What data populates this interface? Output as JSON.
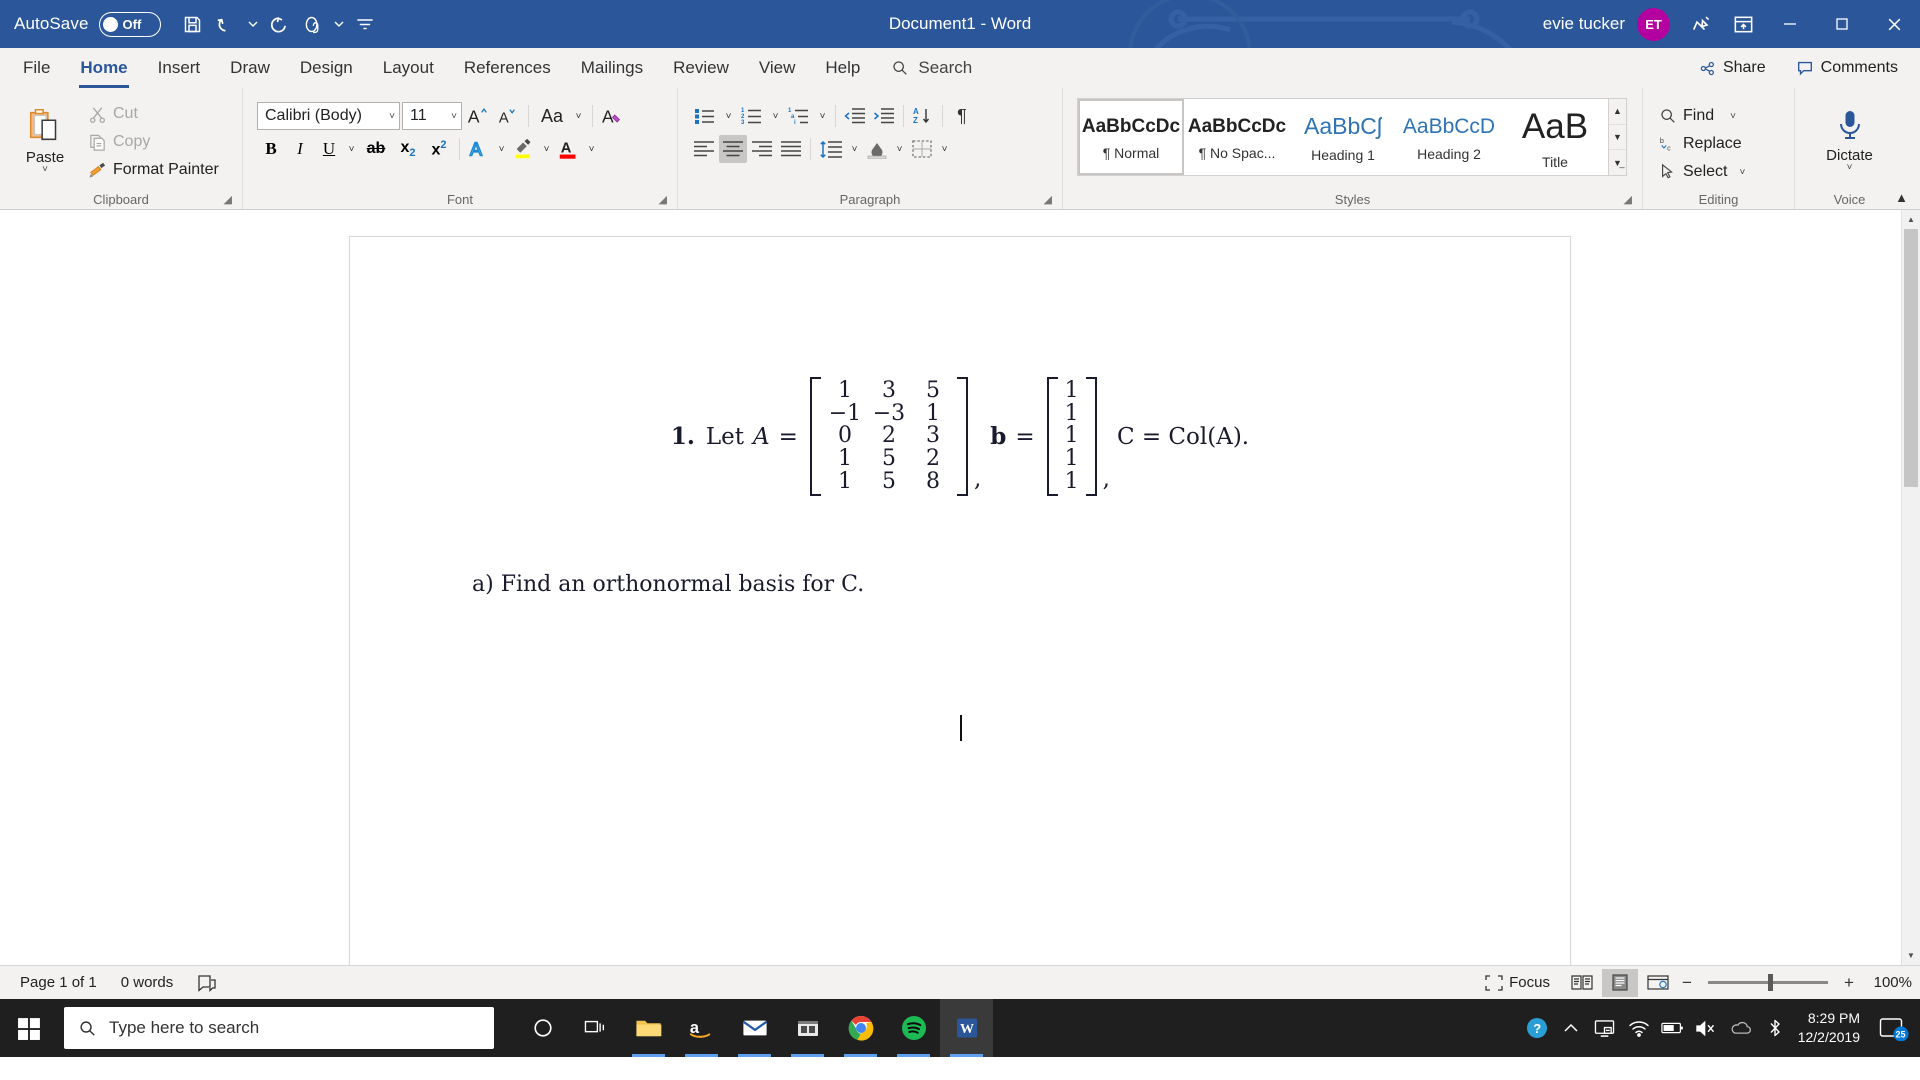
{
  "titlebar": {
    "autosave_label": "AutoSave",
    "autosave_state": "Off",
    "document_title": "Document1  -  Word",
    "user_name": "evie tucker",
    "avatar_initials": "ET",
    "accent_color": "#2b579a",
    "avatar_color": "#b4009e",
    "qat": [
      {
        "name": "save-icon",
        "tooltip": "Save"
      },
      {
        "name": "undo-icon",
        "tooltip": "Undo"
      },
      {
        "name": "redo-icon",
        "tooltip": "Redo"
      },
      {
        "name": "touch-mode-icon",
        "tooltip": "Touch/Mouse Mode"
      },
      {
        "name": "customize-qat-icon",
        "tooltip": "Customize Quick Access Toolbar"
      }
    ],
    "window_controls": {
      "minimize": "–",
      "restore": "❐",
      "close": "✕"
    }
  },
  "tabs": [
    {
      "label": "File",
      "active": false
    },
    {
      "label": "Home",
      "active": true
    },
    {
      "label": "Insert",
      "active": false
    },
    {
      "label": "Draw",
      "active": false
    },
    {
      "label": "Design",
      "active": false
    },
    {
      "label": "Layout",
      "active": false
    },
    {
      "label": "References",
      "active": false
    },
    {
      "label": "Mailings",
      "active": false
    },
    {
      "label": "Review",
      "active": false
    },
    {
      "label": "View",
      "active": false
    },
    {
      "label": "Help",
      "active": false
    }
  ],
  "search": {
    "label": "Search"
  },
  "tabbar_right": {
    "share_label": "Share",
    "comments_label": "Comments"
  },
  "ribbon": {
    "clipboard": {
      "group_label": "Clipboard",
      "paste_label": "Paste",
      "cut_label": "Cut",
      "copy_label": "Copy",
      "format_painter_label": "Format Painter"
    },
    "font": {
      "group_label": "Font",
      "font_family_value": "Calibri (Body)",
      "font_size_value": "11",
      "grow_font": "A",
      "shrink_font": "A",
      "change_case": "Aa",
      "clear_formatting": "A",
      "bold": "B",
      "italic": "I",
      "underline": "U",
      "strikethrough": "ab",
      "subscript": "x",
      "superscript": "x",
      "text_effects": "A",
      "highlight_color": "#ffff00",
      "font_color": "#ff0000"
    },
    "paragraph": {
      "group_label": "Paragraph",
      "bullets": "bullets-icon",
      "numbering": "numbering-icon",
      "multilevel": "multilevel-list-icon",
      "decrease_indent": "decrease-indent-icon",
      "increase_indent": "increase-indent-icon",
      "sort": "sort-icon",
      "show_marks": "¶",
      "align_left": "align-left-icon",
      "align_center": "align-center-icon",
      "align_right": "align-right-icon",
      "justify": "justify-icon",
      "line_spacing": "line-spacing-icon",
      "shading": "shading-icon",
      "borders": "borders-icon",
      "active_alignment": "align-center"
    },
    "styles": {
      "group_label": "Styles",
      "items": [
        {
          "preview": "AaBbCcDc",
          "name": "¶ Normal",
          "active": true,
          "style": "normal"
        },
        {
          "preview": "AaBbCcDc",
          "name": "¶ No Spac...",
          "active": false,
          "style": "nospacing"
        },
        {
          "preview": "AaBbCʃ",
          "name": "Heading 1",
          "active": false,
          "style": "heading1"
        },
        {
          "preview": "AaBbCcD",
          "name": "Heading 2",
          "active": false,
          "style": "heading2"
        },
        {
          "preview": "AaB",
          "name": "Title",
          "active": false,
          "style": "title"
        }
      ]
    },
    "editing": {
      "group_label": "Editing",
      "find_label": "Find",
      "replace_label": "Replace",
      "select_label": "Select"
    },
    "voice": {
      "group_label": "Voice",
      "dictate_label": "Dictate"
    }
  },
  "document": {
    "problem_number": "1.",
    "let_text": "Let",
    "matrix_A_name": "A",
    "equals": "=",
    "matrix_A": [
      [
        "1",
        "3",
        "5"
      ],
      [
        "−1",
        "−3",
        "1"
      ],
      [
        "0",
        "2",
        "3"
      ],
      [
        "1",
        "5",
        "2"
      ],
      [
        "1",
        "5",
        "8"
      ]
    ],
    "comma1": ",",
    "vector_b_name": "b",
    "vector_b": [
      [
        "1"
      ],
      [
        "1"
      ],
      [
        "1"
      ],
      [
        "1"
      ],
      [
        "1"
      ]
    ],
    "comma2": ",",
    "col_statement": "C = Col(A).",
    "part_a": "a) Find an orthonormal basis for C."
  },
  "statusbar": {
    "page_info": "Page 1 of 1",
    "word_count": "0 words",
    "proofing_icon": "proofing-errors-icon",
    "focus_label": "Focus",
    "view_read": "read-mode-icon",
    "view_print": "print-layout-icon",
    "view_web": "web-layout-icon",
    "zoom_out": "−",
    "zoom_in": "+",
    "zoom_level": "100%"
  },
  "taskbar": {
    "search_placeholder": "Type here to search",
    "apps": [
      {
        "name": "cortana-icon",
        "label": "Cortana"
      },
      {
        "name": "task-view-icon",
        "label": "Task View"
      },
      {
        "name": "file-explorer-icon",
        "label": "File Explorer"
      },
      {
        "name": "amazon-icon",
        "label": "Amazon"
      },
      {
        "name": "mail-icon",
        "label": "Mail"
      },
      {
        "name": "microsoft-store-icon",
        "label": "Microsoft Store"
      },
      {
        "name": "chrome-icon",
        "label": "Google Chrome"
      },
      {
        "name": "spotify-icon",
        "label": "Spotify"
      },
      {
        "name": "word-icon",
        "label": "Word"
      }
    ],
    "tray": [
      {
        "name": "help-circle-icon"
      },
      {
        "name": "show-hidden-icons-chevron"
      },
      {
        "name": "display-icon"
      },
      {
        "name": "wifi-icon"
      },
      {
        "name": "battery-icon"
      },
      {
        "name": "volume-mute-icon"
      },
      {
        "name": "onedrive-icon"
      },
      {
        "name": "bluetooth-icon"
      }
    ],
    "time": "8:29 PM",
    "date": "12/2/2019",
    "notification_count": "25"
  }
}
